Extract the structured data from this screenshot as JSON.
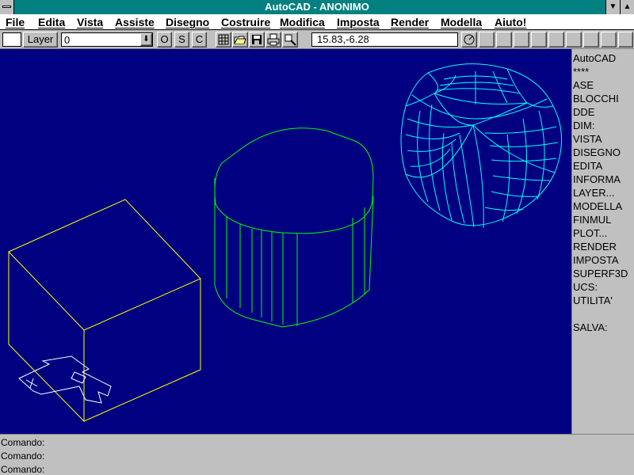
{
  "window": {
    "title": "AutoCAD - ANONIMO"
  },
  "menu": [
    "File",
    "Edita",
    "Vista",
    "Assiste",
    "Disegno",
    "Costruire",
    "Modifica",
    "Imposta",
    "Render",
    "Modella",
    "Aiuto!"
  ],
  "toolbar": {
    "layer_label": "Layer",
    "layer_value": "0",
    "osnap_buttons": [
      "O",
      "S",
      "C"
    ],
    "coords": "15.83,-6.28"
  },
  "side_menu": {
    "header": "AutoCAD",
    "stars": "****",
    "items": [
      "ASE",
      "BLOCCHI",
      "DDE",
      "DIM:",
      "VISTA",
      "DISEGNO",
      "EDITA",
      "INFORMA",
      "LAYER...",
      "MODELLA",
      "FINMUL",
      "PLOT...",
      "RENDER",
      "IMPOSTA",
      "SUPERF3D",
      "UCS:",
      "UTILITA'"
    ],
    "save": "SALVA:"
  },
  "command_lines": [
    "Comando:",
    "Comando:",
    "Comando:"
  ],
  "colors": {
    "canvas": "#000080",
    "title": "#008080",
    "box": "#ffff00",
    "cylinder": "#00ff00",
    "sphere": "#00ffff"
  }
}
